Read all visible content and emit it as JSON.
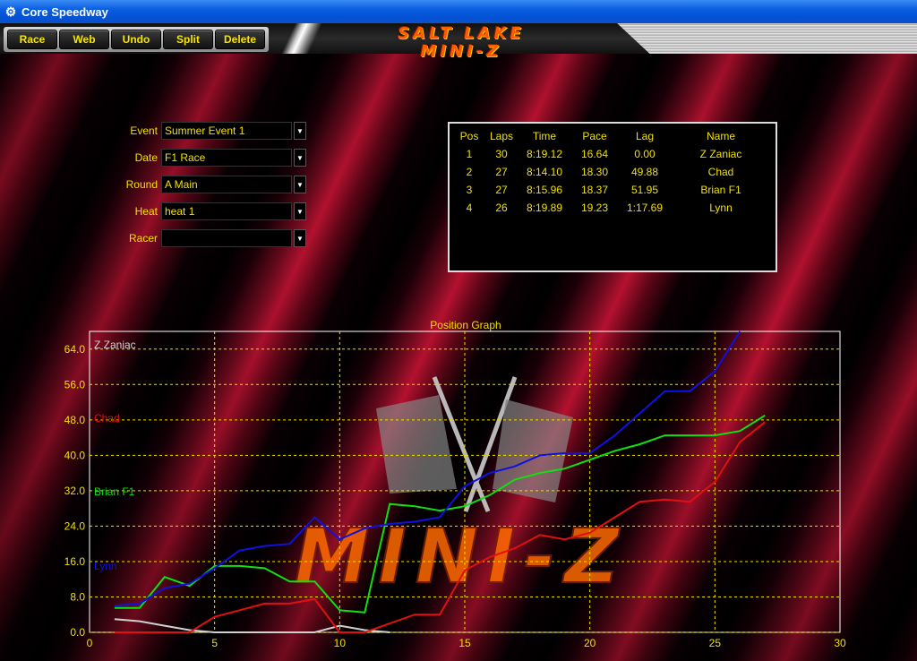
{
  "window": {
    "title": "Core Speedway"
  },
  "toolbar": {
    "buttons": [
      "Race",
      "Web",
      "Undo",
      "Split",
      "Delete"
    ]
  },
  "logo": {
    "line1": "SALT LAKE",
    "line2": "MINI-Z"
  },
  "form": {
    "event_label": "Event",
    "event_value": "Summer Event 1",
    "date_label": "Date",
    "date_value": "F1 Race",
    "round_label": "Round",
    "round_value": "A Main",
    "heat_label": "Heat",
    "heat_value": "heat 1",
    "racer_label": "Racer",
    "racer_value": ""
  },
  "results": {
    "headers": [
      "Pos",
      "Laps",
      "Time",
      "Pace",
      "Lag",
      "Name"
    ],
    "rows": [
      [
        "1",
        "30",
        "8:19.12",
        "16.64",
        "0.00",
        "Z Zaniac"
      ],
      [
        "2",
        "27",
        "8:14.10",
        "18.30",
        "49.88",
        "Chad"
      ],
      [
        "3",
        "27",
        "8:15.96",
        "18.37",
        "51.95",
        "Brian F1"
      ],
      [
        "4",
        "26",
        "8:19.89",
        "19.23",
        "1:17.69",
        "Lynn"
      ]
    ]
  },
  "chart_data": {
    "type": "line",
    "title": "Position Graph",
    "xlim": [
      0,
      30
    ],
    "ylim": [
      0,
      68
    ],
    "x_ticks": [
      0,
      5,
      10,
      15,
      20,
      25,
      30
    ],
    "y_ticks": [
      "0.0",
      "8.0",
      "16.0",
      "24.0",
      "32.0",
      "40.0",
      "48.0",
      "56.0",
      "64.0"
    ],
    "grid": true,
    "background_watermark": "MINI-Z",
    "series": [
      {
        "name": "Z Zaniac",
        "color": "#d0d0d0",
        "x": [
          1,
          2,
          3,
          4,
          5,
          6,
          7,
          8,
          9,
          10,
          11,
          12
        ],
        "y": [
          3,
          2.5,
          1.5,
          0.5,
          0,
          0,
          0,
          0,
          0,
          1.5,
          0.5,
          0
        ]
      },
      {
        "name": "Chad",
        "color": "#e01010",
        "x": [
          1,
          2,
          3,
          4,
          5,
          6,
          7,
          8,
          9,
          10,
          11,
          12,
          13,
          14,
          15,
          16,
          17,
          18,
          19,
          20,
          21,
          22,
          23,
          24,
          25,
          26,
          27
        ],
        "y": [
          0,
          0,
          0,
          0,
          3.5,
          5,
          6.5,
          6.5,
          7.5,
          0,
          0,
          2,
          4,
          4,
          14,
          17,
          19,
          22,
          21,
          22.5,
          26,
          29.5,
          30,
          29.5,
          34,
          43,
          47.5
        ]
      },
      {
        "name": "Brian F1",
        "color": "#10e010",
        "x": [
          1,
          2,
          3,
          4,
          5,
          6,
          7,
          8,
          9,
          10,
          11,
          12,
          13,
          14,
          15,
          16,
          17,
          18,
          19,
          20,
          21,
          22,
          23,
          24,
          25,
          26,
          27
        ],
        "y": [
          5.5,
          5.5,
          12.5,
          10.5,
          15,
          15,
          14.5,
          11.5,
          11.5,
          5,
          4.5,
          29,
          28.5,
          27.5,
          28.5,
          31,
          34.5,
          36,
          37,
          39,
          41,
          42.5,
          44.5,
          44.5,
          44.5,
          45.5,
          49
        ]
      },
      {
        "name": "Lynn",
        "color": "#1010e0",
        "x": [
          1,
          2,
          3,
          4,
          5,
          6,
          7,
          8,
          9,
          10,
          11,
          12,
          13,
          14,
          15,
          16,
          17,
          18,
          19,
          20,
          21,
          22,
          23,
          24,
          25,
          26
        ],
        "y": [
          6,
          6.5,
          10,
          11,
          14.5,
          18.5,
          19.5,
          20,
          26,
          21,
          23.5,
          24.5,
          25,
          26,
          33,
          36,
          37.5,
          40,
          40.5,
          40.5,
          44.5,
          49.5,
          54.5,
          54.5,
          59,
          68
        ]
      }
    ]
  }
}
